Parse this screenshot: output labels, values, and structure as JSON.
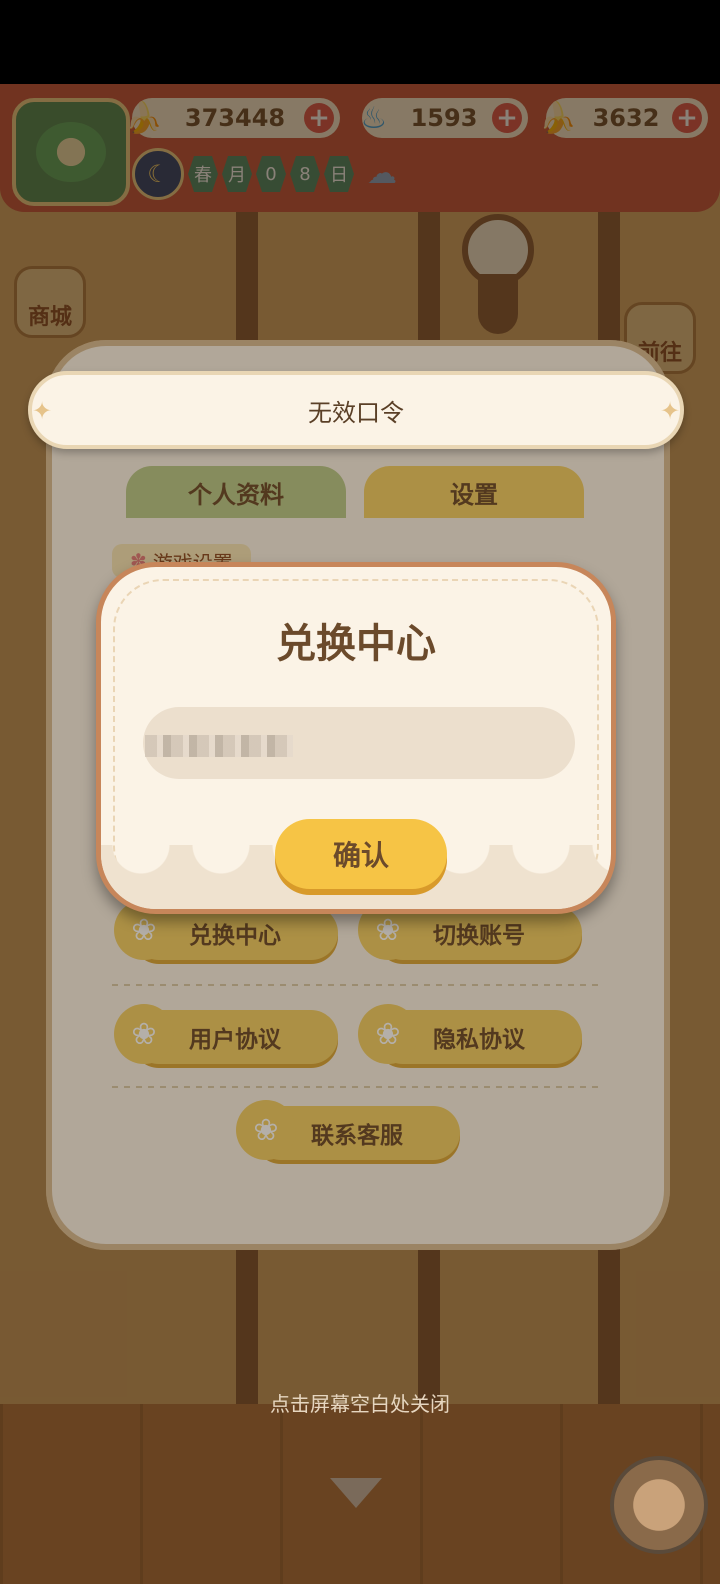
{
  "topbar": {
    "resources": [
      {
        "icon": "banana-icon",
        "value": "373448"
      },
      {
        "icon": "blue-flame-icon",
        "value": "1593"
      },
      {
        "icon": "blue-banana-icon",
        "value": "3632"
      }
    ],
    "date_cells": [
      "春",
      "月",
      "0",
      "8",
      "日"
    ],
    "weather_icon": "rain-cloud-icon"
  },
  "side_menu": {
    "left": [
      {
        "label": "商城"
      }
    ],
    "right": [
      {
        "label": "前往"
      }
    ]
  },
  "settings_panel": {
    "tabs": [
      "个人资料",
      "设置"
    ],
    "section_label": "游戏设置",
    "buttons": [
      "兑换中心",
      "切换账号",
      "用户协议",
      "隐私协议",
      "联系客服"
    ]
  },
  "toast": {
    "message": "无效口令"
  },
  "exchange_dialog": {
    "title": "兑换中心",
    "input_value": "",
    "confirm_label": "确认"
  },
  "footer": {
    "close_hint": "点击屏幕空白处关闭"
  },
  "colors": {
    "accent": "#f6c445",
    "brown_text": "#6b4a2b",
    "topbar": "#c9533d"
  }
}
